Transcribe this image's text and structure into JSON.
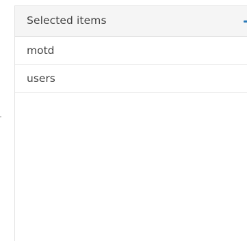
{
  "panel": {
    "title": "Selected items",
    "collapse_icon": "minus-icon",
    "accent_color": "#2a7ab8",
    "items": [
      {
        "label": "motd"
      },
      {
        "label": "users"
      }
    ]
  }
}
